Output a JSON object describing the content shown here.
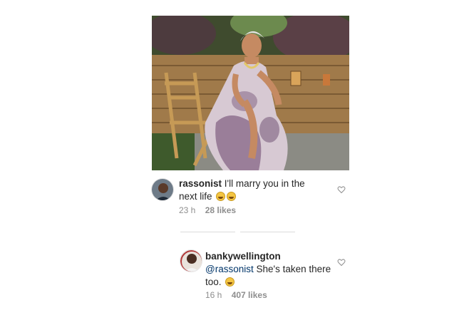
{
  "post": {
    "image_alt": "Woman seated on a wooden folding chair in a garden"
  },
  "comments": [
    {
      "username": "rassonist",
      "text": "I'll marry you in the next life",
      "emoji": [
        "grimacing-face",
        "grimacing-face"
      ],
      "time": "23 h",
      "likes": "28 likes"
    },
    {
      "username": "bankywellington",
      "mention": "@rassonist",
      "text": "She's taken there too.",
      "emoji": [
        "smirking-face"
      ],
      "time": "16 h",
      "likes": "407 likes"
    }
  ],
  "colors": {
    "text": "#262626",
    "meta": "#8e8e8e",
    "mention": "#003569",
    "divider": "#dbdbdb"
  }
}
